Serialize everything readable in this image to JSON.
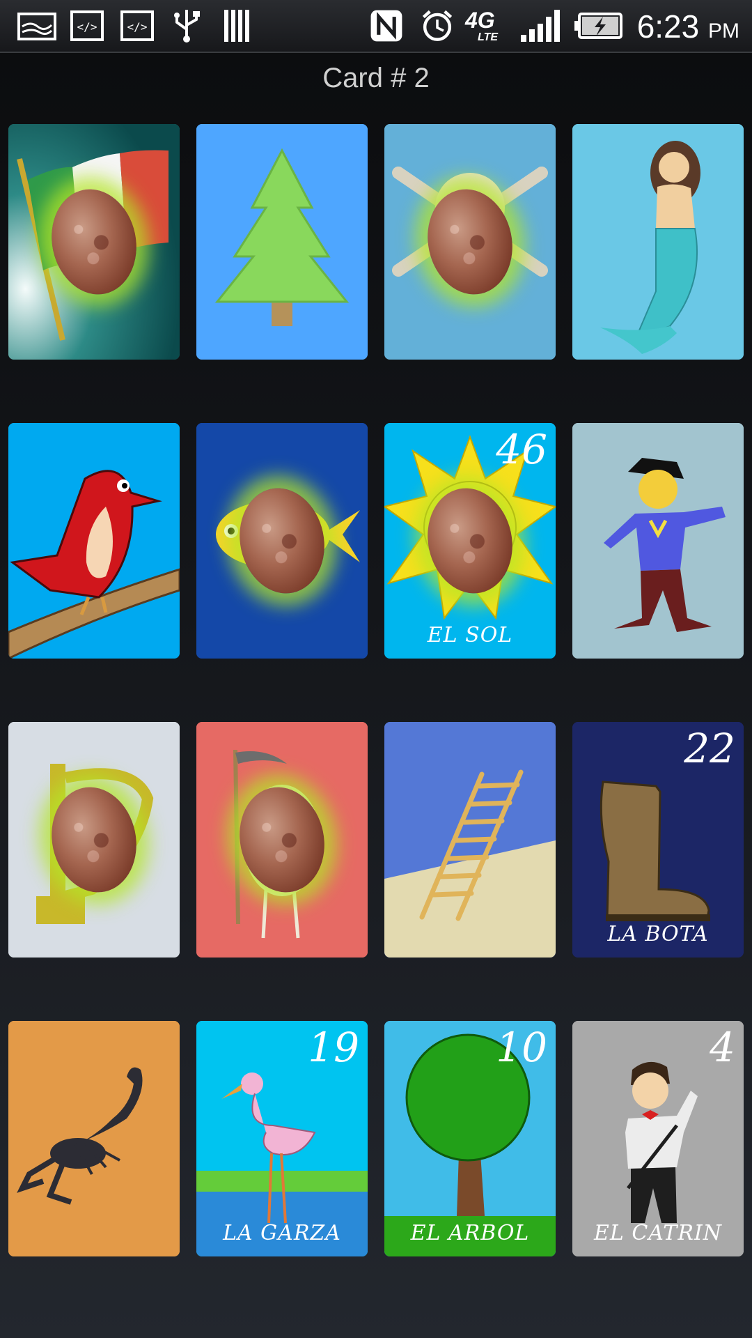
{
  "status": {
    "time": "6:23",
    "ampm": "PM",
    "network": "4G",
    "network_sub": "LTE"
  },
  "title": "Card # 2",
  "cards": [
    {
      "icon": "mexican-flag-icon",
      "bg": "#2d8a86",
      "marked": true,
      "number": "",
      "name": ""
    },
    {
      "icon": "pine-tree-icon",
      "bg": "#4ea6ff",
      "marked": false,
      "number": "",
      "name": ""
    },
    {
      "icon": "skull-crossbones-icon",
      "bg": "#63b0d8",
      "marked": true,
      "number": "",
      "name": ""
    },
    {
      "icon": "mermaid-icon",
      "bg": "#6ac8e6",
      "marked": false,
      "number": "",
      "name": ""
    },
    {
      "icon": "cardinal-bird-icon",
      "bg": "#00a9f0",
      "marked": false,
      "number": "",
      "name": ""
    },
    {
      "icon": "fish-icon",
      "bg": "#1448a8",
      "marked": true,
      "number": "",
      "name": ""
    },
    {
      "icon": "sun-icon",
      "bg": "#00b6ee",
      "marked": true,
      "number": "46",
      "name": "EL SOL"
    },
    {
      "icon": "hero-man-icon",
      "bg": "#a2c4cf",
      "marked": false,
      "number": "",
      "name": ""
    },
    {
      "icon": "harp-icon",
      "bg": "#d7dde4",
      "marked": true,
      "number": "",
      "name": ""
    },
    {
      "icon": "death-scythe-icon",
      "bg": "#e66a64",
      "marked": true,
      "number": "",
      "name": ""
    },
    {
      "icon": "ladder-icon",
      "bg": "#5478d6",
      "marked": false,
      "number": "",
      "name": ""
    },
    {
      "icon": "boot-icon",
      "bg": "#1c2666",
      "marked": false,
      "number": "22",
      "name": "LA BOTA"
    },
    {
      "icon": "scorpion-icon",
      "bg": "#e39a48",
      "marked": false,
      "number": "",
      "name": ""
    },
    {
      "icon": "flamingo-heron-icon",
      "bg": "#00c4f0",
      "marked": false,
      "number": "19",
      "name": "LA GARZA"
    },
    {
      "icon": "tree-icon",
      "bg": "#40bce8",
      "marked": false,
      "number": "10",
      "name": "EL ARBOL"
    },
    {
      "icon": "dandy-man-icon",
      "bg": "#a9a9a9",
      "marked": false,
      "number": "4",
      "name": "EL CATRIN"
    }
  ]
}
